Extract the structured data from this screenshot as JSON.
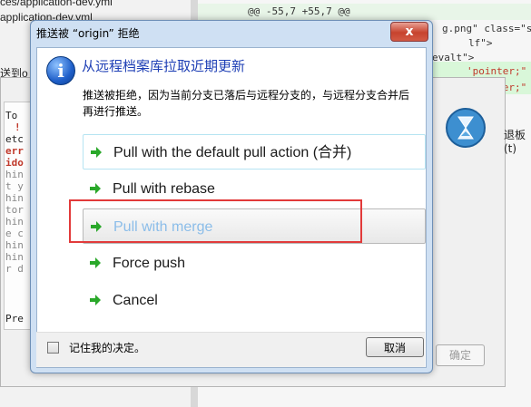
{
  "background": {
    "files": [
      "ces/application-dev.yml",
      "application-dev.yml"
    ],
    "send_label": "送到o",
    "diff_hunk": "@@ -55,7 +55,7 @@",
    "diff_lines": [
      "g.png\" class=\"s",
      "lf\">",
      "evalt\">"
    ],
    "diff_red_lines": [
      "'pointer;\"",
      "'pointer;\""
    ],
    "console_lines": [
      "To",
      "!",
      "etc",
      "err",
      "ido",
      "hin",
      "t y",
      "hin",
      "tor",
      "hin",
      "e c",
      "hin",
      "hin",
      "r d",
      "",
      "Pre"
    ],
    "side_text": "退板(t)",
    "confirm_button": "确定"
  },
  "dialog": {
    "title": "推送被 “origin” 拒绝",
    "close_symbol": "x",
    "info_symbol": "i",
    "heading": "从远程档案库拉取近期更新",
    "description": "推送被拒绝，因为当前分支已落后与远程分支的，与远程分支合并后再进行推送。",
    "options": [
      {
        "label": "Pull with the default pull action (合并)"
      },
      {
        "label": "Pull with rebase"
      },
      {
        "label": "Pull with merge"
      },
      {
        "label": "Force push"
      },
      {
        "label": "Cancel"
      }
    ],
    "remember_label": "记住我的决定。",
    "cancel_button": "取消"
  },
  "colors": {
    "heading": "#1e3fb5",
    "arrow": "#2aa82a",
    "highlight_box": "#e23a3a",
    "hover_text": "#8bbde9"
  }
}
